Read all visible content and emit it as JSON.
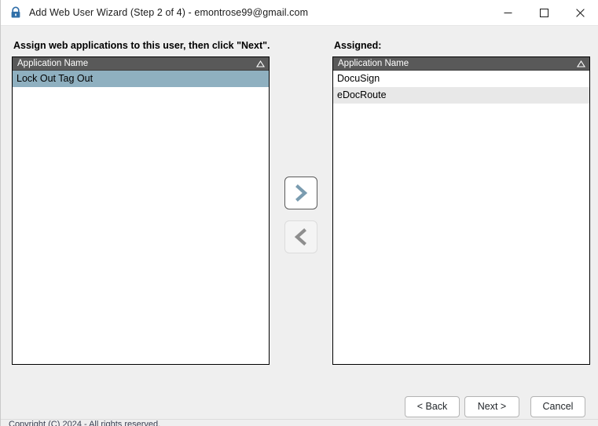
{
  "window": {
    "title": "Add Web User Wizard (Step 2 of 4) - emontrose99@gmail.com",
    "icon": "lock-icon",
    "caption": {
      "minimize": "minimize-icon",
      "maximize": "maximize-icon",
      "close": "close-icon"
    }
  },
  "main": {
    "instruction": "Assign web applications to this user, then click \"Next\".",
    "assigned_label": "Assigned:",
    "available_list": {
      "header": "Application Name",
      "sort_indicator": "sort-ascending-icon",
      "rows": [
        {
          "label": "Lock Out Tag Out",
          "state": "selected"
        }
      ]
    },
    "assigned_list": {
      "header": "Application Name",
      "sort_indicator": "sort-ascending-icon",
      "rows": [
        {
          "label": "DocuSign",
          "state": "plain"
        },
        {
          "label": "eDocRoute",
          "state": "alt"
        }
      ]
    },
    "transfer": {
      "assign_label": "chevron-right-icon",
      "unassign_label": "chevron-left-icon"
    }
  },
  "footer": {
    "back": "< Back",
    "next": "Next >",
    "cancel": "Cancel"
  },
  "statusbar": {
    "text": "Copyright (C) 2024 - All rights reserved."
  },
  "colors": {
    "window_bg": "#efefef",
    "titlebar_bg": "#ffffff",
    "list_header_bg": "#595959",
    "selection": "#8fb0c0",
    "alt_row": "#e8e8e8",
    "accent_chevron": "#7a9cb0"
  }
}
